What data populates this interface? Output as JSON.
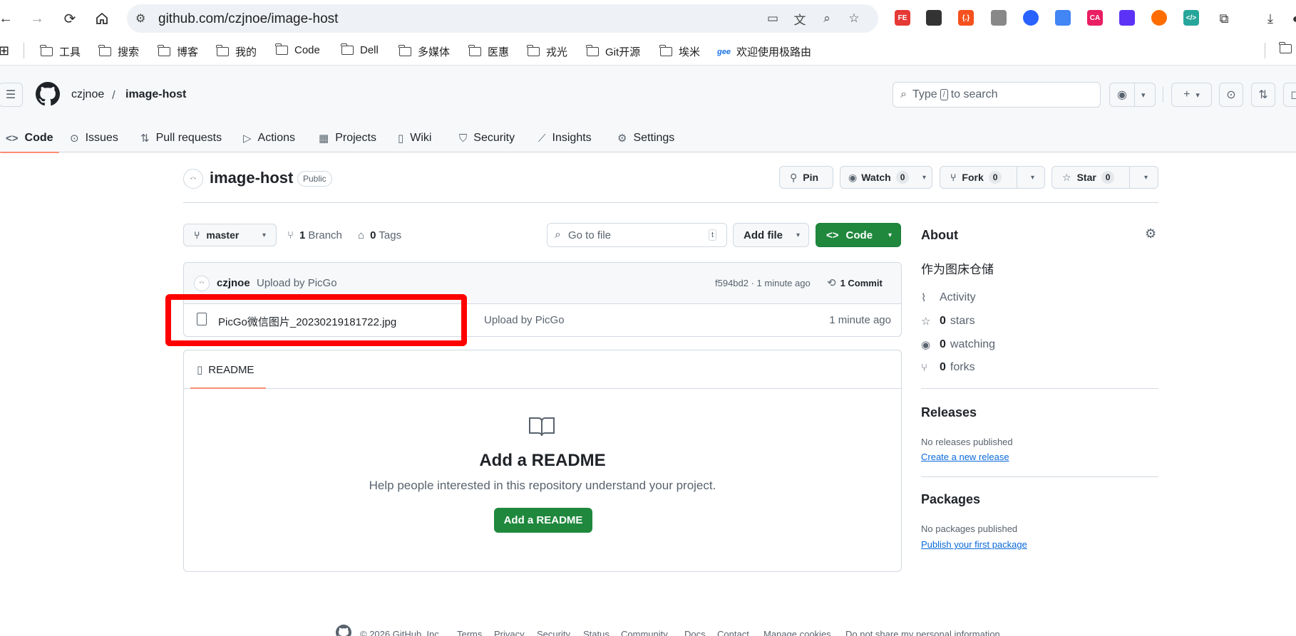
{
  "browser": {
    "url": "github.com/czjnoe/image-host",
    "extensions": [
      "FE",
      "",
      "{.}",
      "",
      "",
      "",
      "CA",
      "",
      "",
      "</>"
    ]
  },
  "bookmarks": [
    {
      "label": "工具"
    },
    {
      "label": "搜索"
    },
    {
      "label": "博客"
    },
    {
      "label": "我的"
    },
    {
      "label": "Code"
    },
    {
      "label": "Dell"
    },
    {
      "label": "多媒体"
    },
    {
      "label": "医惠"
    },
    {
      "label": "戎光"
    },
    {
      "label": "Git开源"
    },
    {
      "label": "埃米"
    },
    {
      "label": "欢迎使用极路由"
    }
  ],
  "header": {
    "owner": "czjnoe",
    "separator": "/",
    "repo": "image-host",
    "search_placeholder_pre": "Type",
    "search_key": "/",
    "search_placeholder_post": "to search"
  },
  "tabs": [
    {
      "label": "Code",
      "icon": "code-icon",
      "active": true
    },
    {
      "label": "Issues",
      "icon": "issue-icon"
    },
    {
      "label": "Pull requests",
      "icon": "pull-request-icon"
    },
    {
      "label": "Actions",
      "icon": "play-icon"
    },
    {
      "label": "Projects",
      "icon": "table-icon"
    },
    {
      "label": "Wiki",
      "icon": "book-icon"
    },
    {
      "label": "Security",
      "icon": "shield-icon"
    },
    {
      "label": "Insights",
      "icon": "graph-icon"
    },
    {
      "label": "Settings",
      "icon": "gear-icon"
    }
  ],
  "repo": {
    "name": "image-host",
    "visibility": "Public",
    "pin": "Pin",
    "watch": "Watch",
    "watch_count": "0",
    "fork": "Fork",
    "fork_count": "0",
    "star": "Star",
    "star_count": "0"
  },
  "toolbar": {
    "branch": "master",
    "branches_count": "1",
    "branches_label": "Branch",
    "tags_count": "0",
    "tags_label": "Tags",
    "goto_placeholder": "Go to file",
    "goto_key": "t",
    "add_file": "Add file",
    "code": "Code"
  },
  "commit": {
    "author": "czjnoe",
    "message": "Upload by PicGo",
    "meta": "f594bd2 · 1 minute ago",
    "commits": "1 Commit"
  },
  "files": [
    {
      "name": "PicGo微信图片_20230219181722.jpg",
      "message": "Upload by PicGo",
      "age": "1 minute ago"
    }
  ],
  "readme": {
    "tab": "README",
    "title": "Add a README",
    "description": "Help people interested in this repository understand your project.",
    "button": "Add a README"
  },
  "about": {
    "title": "About",
    "description": "作为图床仓储",
    "activity": "Activity",
    "stars_count": "0",
    "stars_label": "stars",
    "watching_count": "0",
    "watching_label": "watching",
    "forks_count": "0",
    "forks_label": "forks"
  },
  "releases": {
    "title": "Releases",
    "empty": "No releases published",
    "link": "Create a new release"
  },
  "packages": {
    "title": "Packages",
    "empty": "No packages published",
    "link": "Publish your first package"
  },
  "footer": {
    "copyright": "© 2026 GitHub, Inc.",
    "links": [
      "Terms",
      "Privacy",
      "Security",
      "Status",
      "Community",
      "Docs",
      "Contact",
      "Manage cookies",
      "Do not share my personal information"
    ]
  },
  "colors": {
    "highlight": "#ff0000",
    "primary_green": "#1f883d",
    "tab_underline": "#fd8c73",
    "link": "#0969da"
  }
}
